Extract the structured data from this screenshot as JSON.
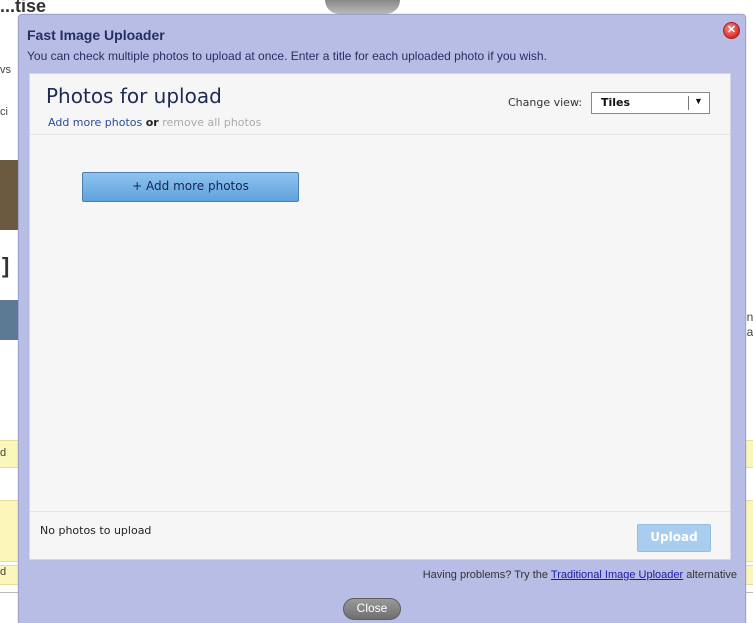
{
  "background": {
    "title_fragment": "...tise",
    "left_letters": [
      "vs",
      "ci",
      "d",
      "d"
    ],
    "right_text": [
      "en",
      "hav"
    ]
  },
  "dialog": {
    "title": "Fast Image Uploader",
    "subtitle": "You can check multiple photos to upload at once. Enter a title for each uploaded photo if you wish.",
    "close_icon": "close-icon",
    "panel": {
      "heading": "Photos for upload",
      "add_more_link": "Add more photos",
      "or_text": "or",
      "remove_all_link": "remove all photos",
      "change_view_label": "Change view:",
      "view_select_value": "Tiles",
      "add_photos_button": "+ Add more photos",
      "status": "No photos to upload",
      "upload_button": "Upload"
    },
    "problems_prefix": "Having problems? Try the",
    "problems_link": "Traditional Image Uploader",
    "problems_suffix": "alternative",
    "close_button": "Close"
  },
  "colors": {
    "dialog_bg": "#b8bde6",
    "accent_button": "#5fa2dc",
    "close_icon": "#d32f2f"
  }
}
